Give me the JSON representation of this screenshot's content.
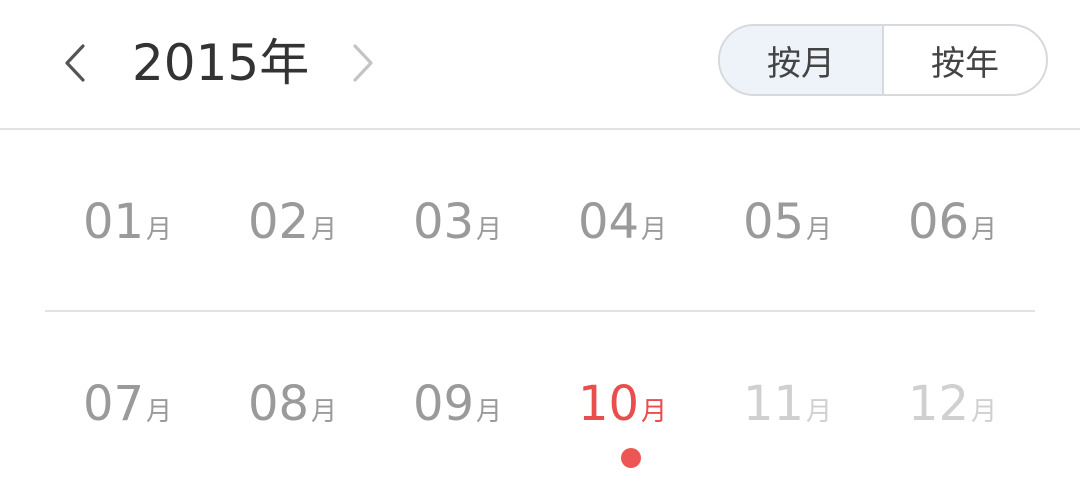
{
  "header": {
    "year_title": "2015年",
    "prev_icon": "chevron-left-icon",
    "next_icon": "chevron-right-icon",
    "view_toggle": {
      "by_month_label": "按月",
      "by_year_label": "按年",
      "active": "by_month"
    }
  },
  "months": [
    {
      "num": "01",
      "unit": "月",
      "state": "normal"
    },
    {
      "num": "02",
      "unit": "月",
      "state": "normal"
    },
    {
      "num": "03",
      "unit": "月",
      "state": "normal"
    },
    {
      "num": "04",
      "unit": "月",
      "state": "normal"
    },
    {
      "num": "05",
      "unit": "月",
      "state": "normal"
    },
    {
      "num": "06",
      "unit": "月",
      "state": "normal"
    },
    {
      "num": "07",
      "unit": "月",
      "state": "normal"
    },
    {
      "num": "08",
      "unit": "月",
      "state": "normal"
    },
    {
      "num": "09",
      "unit": "月",
      "state": "normal"
    },
    {
      "num": "10",
      "unit": "月",
      "state": "selected"
    },
    {
      "num": "11",
      "unit": "月",
      "state": "disabled"
    },
    {
      "num": "12",
      "unit": "月",
      "state": "disabled"
    }
  ],
  "colors": {
    "text_normal": "#9a9a9a",
    "text_selected": "#e94d4d",
    "text_disabled": "#d0d0d0",
    "toggle_active_bg": "#eef3fa",
    "selected_dot": "#ee5555"
  }
}
